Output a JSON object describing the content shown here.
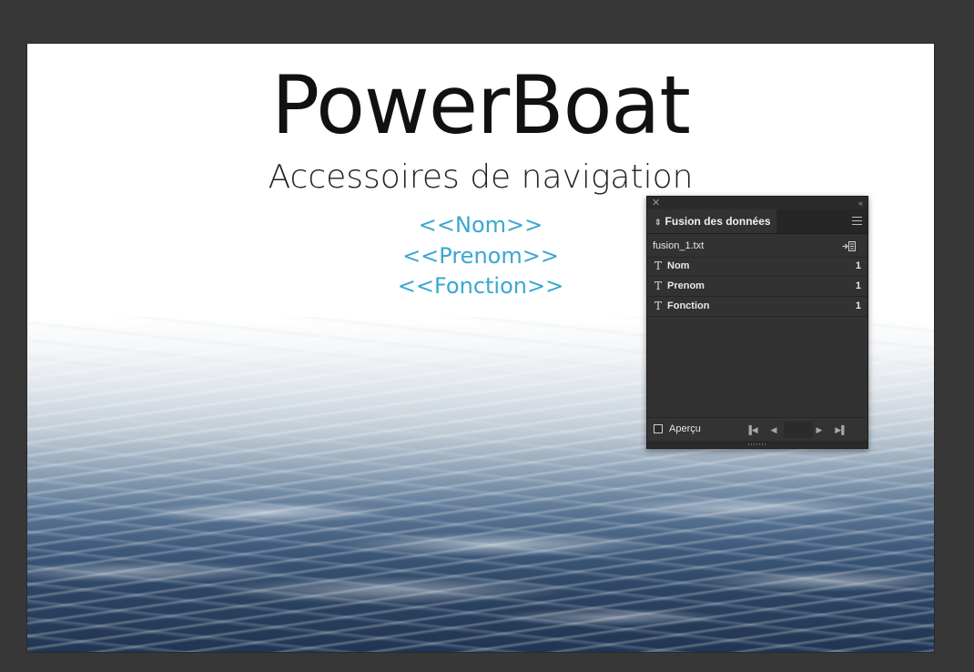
{
  "document": {
    "title": "PowerBoat",
    "subtitle": "Accessoires de navigation",
    "placeholders": [
      "<<Nom>>",
      "<<Prenom>>",
      "<<Fonction>>"
    ]
  },
  "panel": {
    "tab_title": "Fusion des données",
    "source_file": "fusion_1.txt",
    "fields": [
      {
        "name": "Nom",
        "count": "1"
      },
      {
        "name": "Prenom",
        "count": "1"
      },
      {
        "name": "Fonction",
        "count": "1"
      }
    ],
    "preview_label": "Aperçu",
    "preview_checked": false
  },
  "colors": {
    "pasteboard": "#373737",
    "placeholder_text": "#3aa7d2",
    "panel_bg": "#323232"
  },
  "icons": {
    "close": "close-icon",
    "collapse": "double-chevron-left-icon",
    "panel_menu": "hamburger-menu-icon",
    "import": "import-data-source-icon",
    "field_type": "text-field-icon",
    "nav": [
      "first-record-icon",
      "previous-record-icon",
      "next-record-icon",
      "last-record-icon"
    ]
  }
}
